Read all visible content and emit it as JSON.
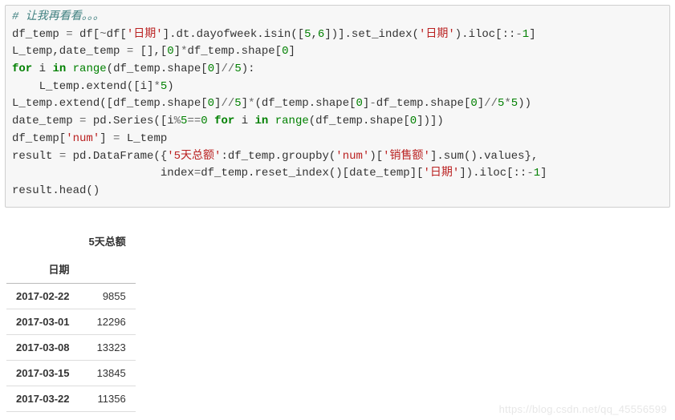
{
  "code": {
    "l1_comment": "# 让我再看看。。。",
    "l2_a": "df_temp ",
    "l2_eq": "=",
    "l2_b": " df[",
    "l2_tilde": "~",
    "l2_c": "df[",
    "l2_s1": "'日期'",
    "l2_d": "].dt.dayofweek.isin([",
    "l2_n1": "5",
    "l2_comma": ",",
    "l2_n2": "6",
    "l2_e": "])].set_index(",
    "l2_s2": "'日期'",
    "l2_f": ").iloc[::",
    "l2_neg1": "-",
    "l2_one": "1",
    "l2_g": "]",
    "l3_a": "L_temp,date_temp ",
    "l3_eq": "=",
    "l3_b": " [],[",
    "l3_n0": "0",
    "l3_c": "]",
    "l3_star": "*",
    "l3_d": "df_temp.shape[",
    "l3_n0b": "0",
    "l3_e": "]",
    "l4_for": "for",
    "l4_a": " i ",
    "l4_in": "in",
    "l4_b": " ",
    "l4_range": "range",
    "l4_c": "(df_temp.shape[",
    "l4_n0": "0",
    "l4_d": "]",
    "l4_fl": "//",
    "l4_n5": "5",
    "l4_e": "):",
    "l5_a": "    L_temp.extend([i]",
    "l5_star": "*",
    "l5_n5": "5",
    "l5_b": ")",
    "l6_a": "L_temp.extend([df_temp.shape[",
    "l6_n0a": "0",
    "l6_b": "]",
    "l6_fl1": "//",
    "l6_n5a": "5",
    "l6_c": "]",
    "l6_star": "*",
    "l6_d": "(df_temp.shape[",
    "l6_n0b": "0",
    "l6_e": "]",
    "l6_minus": "-",
    "l6_f": "df_temp.shape[",
    "l6_n0c": "0",
    "l6_g": "]",
    "l6_fl2": "//",
    "l6_n5b": "5",
    "l6_star2": "*",
    "l6_n5c": "5",
    "l6_h": "))",
    "l7_a": "date_temp ",
    "l7_eq": "=",
    "l7_b": " pd.Series([i",
    "l7_mod": "%",
    "l7_n5": "5",
    "l7_eqeq": "==",
    "l7_n0": "0",
    "l7_sp": " ",
    "l7_for": "for",
    "l7_c": " i ",
    "l7_in": "in",
    "l7_d": " ",
    "l7_range": "range",
    "l7_e": "(df_temp.shape[",
    "l7_n0b": "0",
    "l7_f": "])])",
    "l8_a": "df_temp[",
    "l8_s": "'num'",
    "l8_b": "] ",
    "l8_eq": "=",
    "l8_c": " L_temp",
    "l9_a": "result ",
    "l9_eq": "=",
    "l9_b": " pd.DataFrame({",
    "l9_s1": "'5天总额'",
    "l9_c": ":df_temp.groupby(",
    "l9_s2": "'num'",
    "l9_d": ")[",
    "l9_s3": "'销售额'",
    "l9_e": "].sum().values},",
    "l10_a": "                      index",
    "l10_eq": "=",
    "l10_b": "df_temp.reset_index()[date_temp][",
    "l10_s1": "'日期'",
    "l10_c": "]).iloc[::",
    "l10_neg": "-",
    "l10_one": "1",
    "l10_d": "]",
    "l11_a": "result.head()"
  },
  "table": {
    "col_header": "5天总额",
    "index_name": "日期",
    "rows": [
      {
        "idx": "2017-02-22",
        "val": "9855"
      },
      {
        "idx": "2017-03-01",
        "val": "12296"
      },
      {
        "idx": "2017-03-08",
        "val": "13323"
      },
      {
        "idx": "2017-03-15",
        "val": "13845"
      },
      {
        "idx": "2017-03-22",
        "val": "11356"
      }
    ]
  },
  "watermark": "https://blog.csdn.net/qq_45556599"
}
